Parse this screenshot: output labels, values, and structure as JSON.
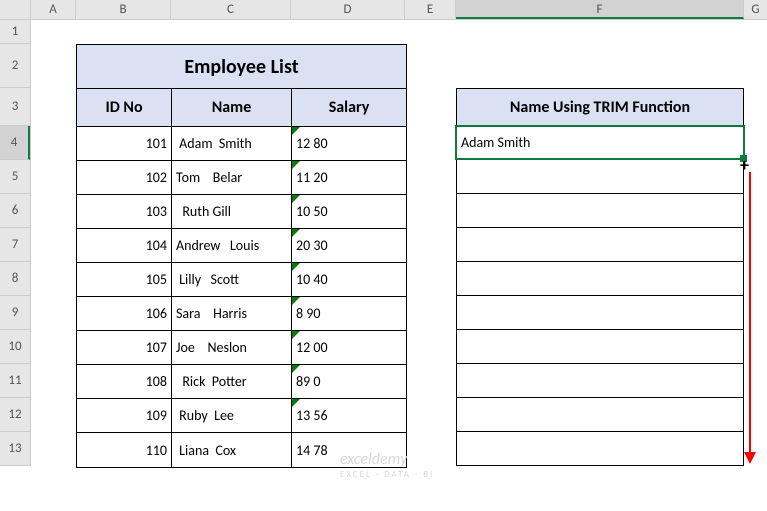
{
  "columns": [
    "A",
    "B",
    "C",
    "D",
    "E",
    "F",
    "G"
  ],
  "row_numbers": [
    1,
    2,
    3,
    4,
    5,
    6,
    7,
    8,
    9,
    10,
    11,
    12,
    13
  ],
  "title": "Employee List",
  "headers": {
    "id": "ID No",
    "name": "Name",
    "salary": "Salary"
  },
  "rows": [
    {
      "id": "101",
      "name": " Adam  Smith",
      "salary": "12 80"
    },
    {
      "id": "102",
      "name": "Tom    Belar",
      "salary": "11 20"
    },
    {
      "id": "103",
      "name": "  Ruth Gill",
      "salary": "10 50"
    },
    {
      "id": "104",
      "name": "Andrew   Louis",
      "salary": "20 30"
    },
    {
      "id": "105",
      "name": " Lilly   Scott",
      "salary": "10 40"
    },
    {
      "id": "106",
      "name": "Sara    Harris",
      "salary": "8 90"
    },
    {
      "id": "107",
      "name": "Joe    Neslon",
      "salary": "12 00"
    },
    {
      "id": "108",
      "name": "  Rick  Potter",
      "salary": "89 0"
    },
    {
      "id": "109",
      "name": " Ruby  Lee",
      "salary": "13 56"
    },
    {
      "id": "110",
      "name": " Liana  Cox",
      "salary": "14 78"
    }
  ],
  "salary_error_flags": [
    true,
    true,
    true,
    true,
    true,
    true,
    true,
    true,
    true,
    false
  ],
  "trim_header": "Name Using TRIM Function",
  "trim_result": "Adam Smith",
  "watermark": {
    "main": "exceldemy",
    "sub": "EXCEL · DATA · BI"
  },
  "selected_col": "F",
  "selected_row": 4,
  "row_heights": {
    "r1": 24,
    "r2": 44,
    "r3": 38,
    "default": 34
  }
}
